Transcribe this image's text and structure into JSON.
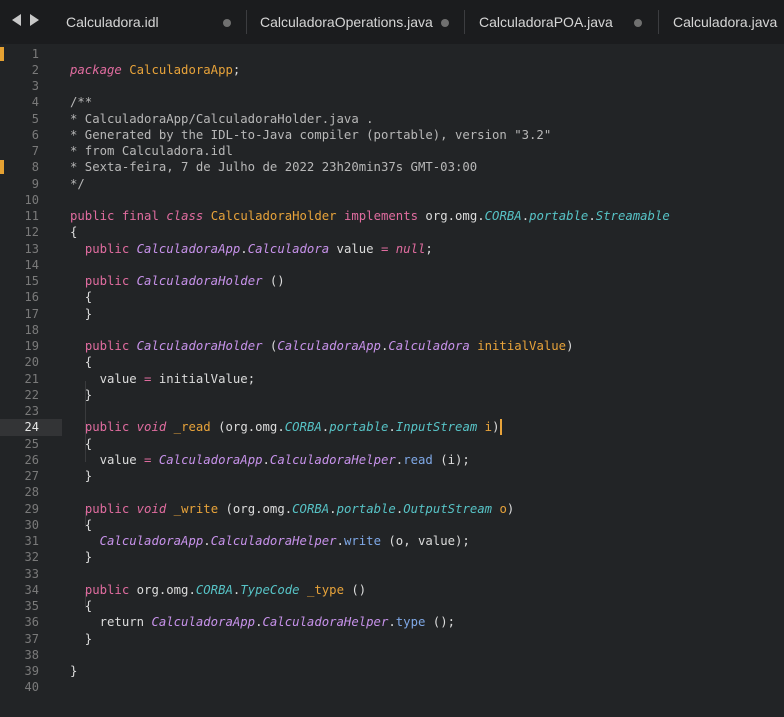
{
  "tabs": [
    {
      "label": "Calculadora.idl",
      "modified": true
    },
    {
      "label": "CalculadoraOperations.java",
      "modified": true
    },
    {
      "label": "CalculadoraPOA.java",
      "modified": true
    },
    {
      "label": "Calculadora.java",
      "modified": false
    }
  ],
  "editor": {
    "current_line": 24,
    "modified_lines": [
      1,
      8
    ],
    "lines": [
      {
        "n": "1",
        "tokens": []
      },
      {
        "n": "2",
        "tokens": [
          [
            "st",
            "package"
          ],
          [
            "pl",
            " "
          ],
          [
            "cls",
            "CalculadoraApp"
          ],
          [
            "pl",
            ";"
          ]
        ]
      },
      {
        "n": "3",
        "tokens": []
      },
      {
        "n": "4",
        "tokens": [
          [
            "cm",
            "/**"
          ]
        ]
      },
      {
        "n": "5",
        "tokens": [
          [
            "cm",
            "* CalculadoraApp/CalculadoraHolder.java ."
          ]
        ]
      },
      {
        "n": "6",
        "tokens": [
          [
            "cm",
            "* Generated by the IDL-to-Java compiler (portable), version \"3.2\""
          ]
        ]
      },
      {
        "n": "7",
        "tokens": [
          [
            "cm",
            "* from Calculadora.idl"
          ]
        ]
      },
      {
        "n": "8",
        "tokens": [
          [
            "cm",
            "* Sexta-feira, 7 de Julho de 2022 23h20min37s GMT-03:00"
          ]
        ]
      },
      {
        "n": "9",
        "tokens": [
          [
            "cm",
            "*/"
          ]
        ]
      },
      {
        "n": "10",
        "tokens": []
      },
      {
        "n": "11",
        "tokens": [
          [
            "kw",
            "public"
          ],
          [
            "pl",
            " "
          ],
          [
            "kw",
            "final"
          ],
          [
            "pl",
            " "
          ],
          [
            "st",
            "class"
          ],
          [
            "pl",
            " "
          ],
          [
            "cls",
            "CalculadoraHolder"
          ],
          [
            "pl",
            " "
          ],
          [
            "kw",
            "implements"
          ],
          [
            "pl",
            " org.omg."
          ],
          [
            "cn",
            "CORBA"
          ],
          [
            "pl",
            "."
          ],
          [
            "cn",
            "portable"
          ],
          [
            "pl",
            "."
          ],
          [
            "cn",
            "Streamable"
          ]
        ]
      },
      {
        "n": "12",
        "tokens": [
          [
            "pl",
            "{"
          ]
        ]
      },
      {
        "n": "13",
        "tokens": [
          [
            "pl",
            "  "
          ],
          [
            "kw",
            "public"
          ],
          [
            "pl",
            " "
          ],
          [
            "ty",
            "CalculadoraApp"
          ],
          [
            "pl",
            "."
          ],
          [
            "ty",
            "Calculadora"
          ],
          [
            "pl",
            " value "
          ],
          [
            "kw",
            "="
          ],
          [
            "pl",
            " "
          ],
          [
            "st",
            "null"
          ],
          [
            "pl",
            ";"
          ]
        ]
      },
      {
        "n": "14",
        "tokens": []
      },
      {
        "n": "15",
        "tokens": [
          [
            "pl",
            "  "
          ],
          [
            "kw",
            "public"
          ],
          [
            "pl",
            " "
          ],
          [
            "ty",
            "CalculadoraHolder"
          ],
          [
            "pl",
            " ()"
          ]
        ]
      },
      {
        "n": "16",
        "tokens": [
          [
            "pl",
            "  {"
          ]
        ]
      },
      {
        "n": "17",
        "tokens": [
          [
            "pl",
            "  }"
          ]
        ]
      },
      {
        "n": "18",
        "tokens": []
      },
      {
        "n": "19",
        "tokens": [
          [
            "pl",
            "  "
          ],
          [
            "kw",
            "public"
          ],
          [
            "pl",
            " "
          ],
          [
            "ty",
            "CalculadoraHolder"
          ],
          [
            "pl",
            " ("
          ],
          [
            "ty",
            "CalculadoraApp"
          ],
          [
            "pl",
            "."
          ],
          [
            "ty",
            "Calculadora"
          ],
          [
            "pl",
            " "
          ],
          [
            "cls",
            "initialValue"
          ],
          [
            "pl",
            ")"
          ]
        ]
      },
      {
        "n": "20",
        "tokens": [
          [
            "pl",
            "  {"
          ]
        ]
      },
      {
        "n": "21",
        "tokens": [
          [
            "pl",
            "    value "
          ],
          [
            "kw",
            "="
          ],
          [
            "pl",
            " initialValue;"
          ]
        ]
      },
      {
        "n": "22",
        "tokens": [
          [
            "pl",
            "  }"
          ]
        ]
      },
      {
        "n": "23",
        "tokens": []
      },
      {
        "n": "24",
        "tokens": [
          [
            "pl",
            "  "
          ],
          [
            "kw",
            "public"
          ],
          [
            "pl",
            " "
          ],
          [
            "st",
            "void"
          ],
          [
            "pl",
            " "
          ],
          [
            "cls",
            "_read"
          ],
          [
            "pl",
            " (org.omg."
          ],
          [
            "cn",
            "CORBA"
          ],
          [
            "pl",
            "."
          ],
          [
            "cn",
            "portable"
          ],
          [
            "pl",
            "."
          ],
          [
            "cn",
            "InputStream"
          ],
          [
            "pl",
            " "
          ],
          [
            "cls",
            "i"
          ],
          [
            "pl",
            ")"
          ]
        ]
      },
      {
        "n": "25",
        "tokens": [
          [
            "pl",
            "  {"
          ]
        ]
      },
      {
        "n": "26",
        "tokens": [
          [
            "pl",
            "    value "
          ],
          [
            "kw",
            "="
          ],
          [
            "pl",
            " "
          ],
          [
            "ty",
            "CalculadoraApp"
          ],
          [
            "pl",
            "."
          ],
          [
            "ty",
            "CalculadoraHelper"
          ],
          [
            "pl",
            "."
          ],
          [
            "fn",
            "read"
          ],
          [
            "pl",
            " (i);"
          ]
        ]
      },
      {
        "n": "27",
        "tokens": [
          [
            "pl",
            "  }"
          ]
        ]
      },
      {
        "n": "28",
        "tokens": []
      },
      {
        "n": "29",
        "tokens": [
          [
            "pl",
            "  "
          ],
          [
            "kw",
            "public"
          ],
          [
            "pl",
            " "
          ],
          [
            "st",
            "void"
          ],
          [
            "pl",
            " "
          ],
          [
            "cls",
            "_write"
          ],
          [
            "pl",
            " (org.omg."
          ],
          [
            "cn",
            "CORBA"
          ],
          [
            "pl",
            "."
          ],
          [
            "cn",
            "portable"
          ],
          [
            "pl",
            "."
          ],
          [
            "cn",
            "OutputStream"
          ],
          [
            "pl",
            " "
          ],
          [
            "cls",
            "o"
          ],
          [
            "pl",
            ")"
          ]
        ]
      },
      {
        "n": "30",
        "tokens": [
          [
            "pl",
            "  {"
          ]
        ]
      },
      {
        "n": "31",
        "tokens": [
          [
            "pl",
            "    "
          ],
          [
            "ty",
            "CalculadoraApp"
          ],
          [
            "pl",
            "."
          ],
          [
            "ty",
            "CalculadoraHelper"
          ],
          [
            "pl",
            "."
          ],
          [
            "fn",
            "write"
          ],
          [
            "pl",
            " (o, value);"
          ]
        ]
      },
      {
        "n": "32",
        "tokens": [
          [
            "pl",
            "  }"
          ]
        ]
      },
      {
        "n": "33",
        "tokens": []
      },
      {
        "n": "34",
        "tokens": [
          [
            "pl",
            "  "
          ],
          [
            "kw",
            "public"
          ],
          [
            "pl",
            " org.omg."
          ],
          [
            "cn",
            "CORBA"
          ],
          [
            "pl",
            "."
          ],
          [
            "cn",
            "TypeCode"
          ],
          [
            "pl",
            " "
          ],
          [
            "cls",
            "_type"
          ],
          [
            "pl",
            " ()"
          ]
        ]
      },
      {
        "n": "35",
        "tokens": [
          [
            "pl",
            "  {"
          ]
        ]
      },
      {
        "n": "36",
        "tokens": [
          [
            "pl",
            "    return "
          ],
          [
            "ty",
            "CalculadoraApp"
          ],
          [
            "pl",
            "."
          ],
          [
            "ty",
            "CalculadoraHelper"
          ],
          [
            "pl",
            "."
          ],
          [
            "fn",
            "type"
          ],
          [
            "pl",
            " ();"
          ]
        ]
      },
      {
        "n": "37",
        "tokens": [
          [
            "pl",
            "  }"
          ]
        ]
      },
      {
        "n": "38",
        "tokens": []
      },
      {
        "n": "39",
        "tokens": [
          [
            "pl",
            "}"
          ]
        ]
      },
      {
        "n": "40",
        "tokens": []
      }
    ]
  },
  "colors": {
    "background": "#222426",
    "tabbar": "#1b1c1e",
    "keyword": "#e06c9f",
    "type": "#c792ea",
    "class_name": "#e8a33a",
    "package_name": "#57c3c6",
    "method": "#7fa8e6",
    "comment": "#b8b8b8",
    "modified_marker": "#e5a132"
  },
  "icons": [
    "nav-back-icon",
    "nav-forward-icon",
    "modified-dot-icon"
  ]
}
